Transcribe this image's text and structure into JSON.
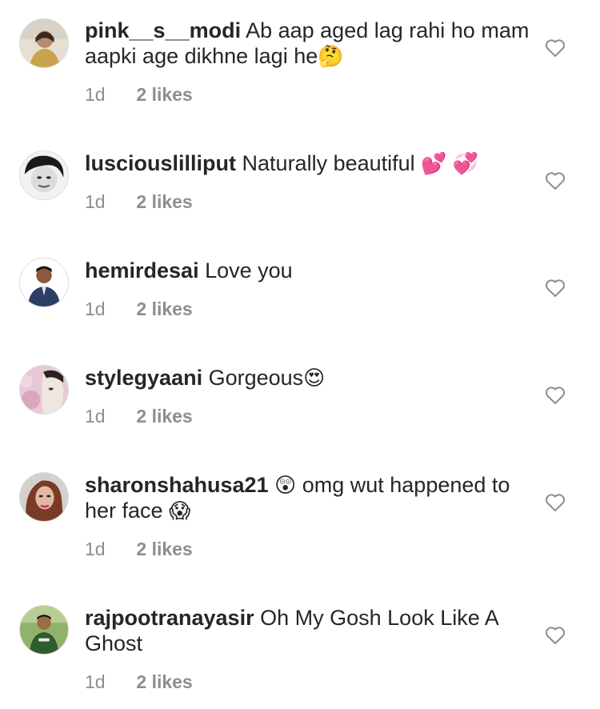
{
  "comments": [
    {
      "username": "pink__s__modi",
      "text": "Ab aap aged lag rahi ho mam aapki age dikhne lagi he",
      "emoji": "🤔",
      "time": "1d",
      "likes": "2 likes"
    },
    {
      "username": "lusciouslilliput",
      "text": "Naturally beautiful",
      "emoji": "💕 💞",
      "time": "1d",
      "likes": "2 likes"
    },
    {
      "username": "hemirdesai",
      "text": "Love you",
      "emoji": "",
      "time": "1d",
      "likes": "2 likes"
    },
    {
      "username": "stylegyaani",
      "text": "Gorgeous",
      "emoji": "😍",
      "time": "1d",
      "likes": "2 likes"
    },
    {
      "username": "sharonshahusa21",
      "emoji_a": "😲",
      "text_a": "omg wut happened to her face",
      "emoji_b": "😱",
      "time": "1d",
      "likes": "2 likes"
    },
    {
      "username": "rajpootranayasir",
      "text": "Oh My Gosh Look Like A Ghost",
      "emoji": "",
      "time": "1d",
      "likes": "2 likes"
    }
  ],
  "colors": {
    "text": "#262626",
    "meta": "#8e8e8e",
    "heart_stroke": "#8e8e8e",
    "background": "#ffffff"
  },
  "icons": {
    "like": "heart-outline-icon"
  }
}
